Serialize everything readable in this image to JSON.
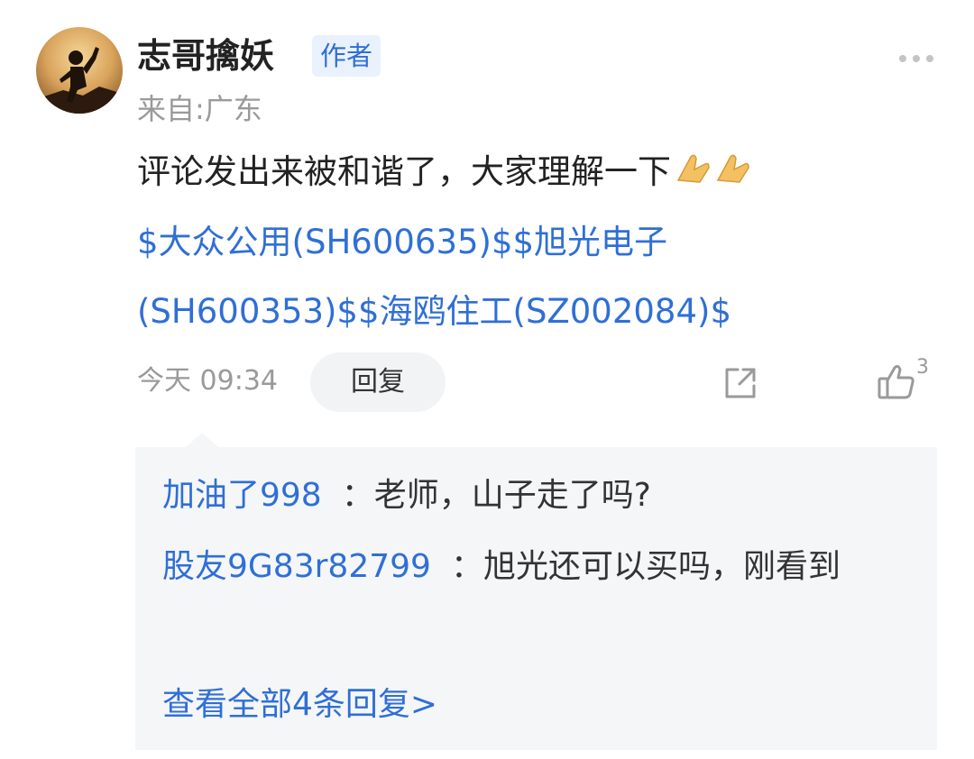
{
  "post": {
    "username": "志哥擒妖",
    "author_badge": "作者",
    "location": "来自:广东",
    "comment_text": "评论发出来被和谐了，大家理解一下",
    "emoji": "🙏🙏",
    "stocks_line1": "$大众公用(SH600635)$$旭光电子",
    "stocks_line2": "(SH600353)$$海鸥住工(SZ002084)$",
    "timestamp": "今天 09:34",
    "reply_label": "回复",
    "like_count": "3"
  },
  "icons": {
    "more": "more-dots-icon",
    "share": "share-icon",
    "like": "thumbs-up-icon"
  },
  "replies": {
    "items": [
      {
        "author": "加油了998",
        "separator": "：",
        "text": "老师，山子走了吗?"
      },
      {
        "author": "股友9G83r82799",
        "separator": "：",
        "text": "旭光还可以买吗，刚看到"
      }
    ],
    "view_all": "查看全部4条回复>"
  },
  "colors": {
    "link_blue": "#2f6fd6",
    "meta_gray": "#9a9a9a",
    "reply_bg": "#f5f6f8"
  }
}
